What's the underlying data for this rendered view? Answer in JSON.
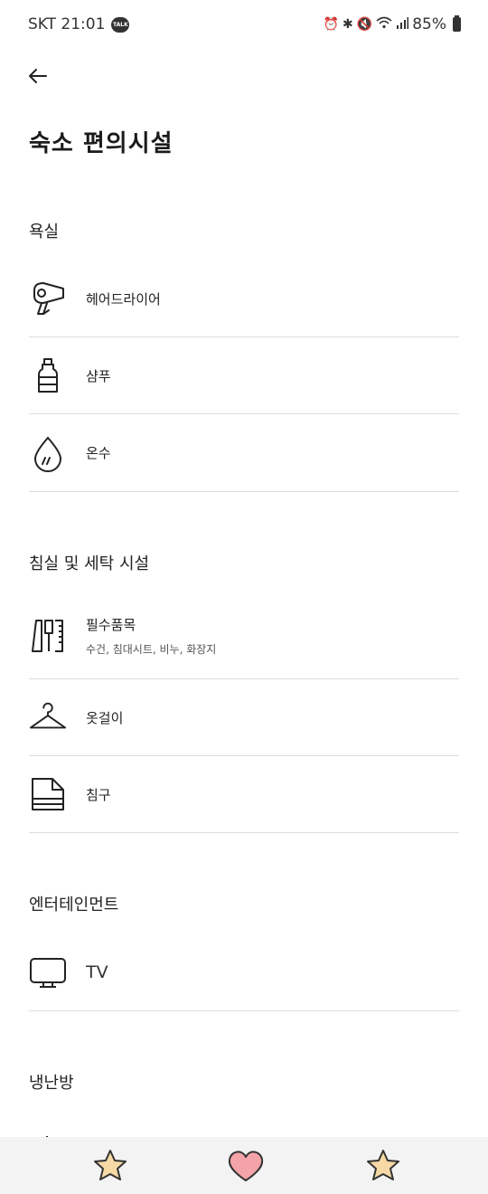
{
  "status_bar": {
    "carrier_time": "SKT 21:01",
    "talk_badge": "TALK",
    "battery": "85%"
  },
  "page": {
    "title": "숙소 편의시설"
  },
  "sections": [
    {
      "title": "욕실",
      "items": [
        {
          "icon": "hair-dryer-icon",
          "label": "헤어드라이어"
        },
        {
          "icon": "shampoo-bottle-icon",
          "label": "샴푸"
        },
        {
          "icon": "hot-water-drop-icon",
          "label": "온수"
        }
      ]
    },
    {
      "title": "침실 및 세탁 시설",
      "items": [
        {
          "icon": "essentials-icon",
          "label": "필수품목",
          "sublabel": "수건, 침대시트, 비누, 화장지"
        },
        {
          "icon": "hanger-icon",
          "label": "옷걸이"
        },
        {
          "icon": "bedding-icon",
          "label": "침구"
        }
      ]
    },
    {
      "title": "엔터테인먼트",
      "items": [
        {
          "icon": "tv-icon",
          "label": "TV"
        }
      ]
    },
    {
      "title": "냉난방",
      "items": []
    }
  ],
  "bottom_bar": {
    "left": "star-icon",
    "center": "heart-icon",
    "right": "star-icon",
    "colors": {
      "star_fill": "#f7d9a6",
      "heart_fill": "#f4a3a8",
      "outline": "#333333"
    }
  }
}
